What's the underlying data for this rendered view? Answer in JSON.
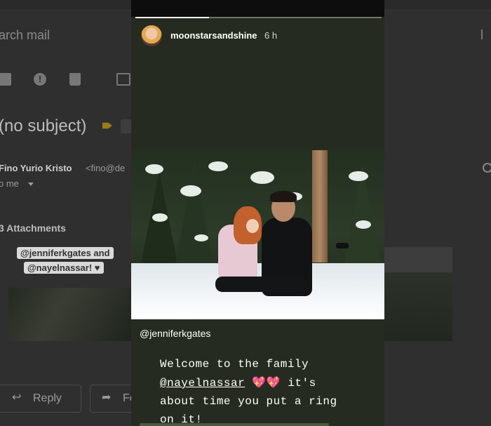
{
  "mail": {
    "search_placeholder": "arch mail",
    "subject": "(no subject)",
    "label_chip_text": "",
    "sender_name": "Fino Yurio Kristo",
    "sender_email": "<fino@de",
    "recipient": "o me",
    "attachments_heading": "3 Attachments",
    "attachment_tag_1": "@jenniferkgates and",
    "attachment_tag_2": "@nayelnassar! ♥",
    "reply_label": "Reply",
    "forward_label": "Fo",
    "spam_glyph": "!",
    "reply_icon": "↩",
    "forward_icon": "➦"
  },
  "story": {
    "username": "moonstarsandshine",
    "timestamp": "6 h",
    "progress": 0.3,
    "mention": "@jenniferkgates",
    "caption_line1": "Welcome to the family",
    "caption_handle": "@nayelnassar",
    "caption_emoji": "💖💖",
    "caption_line2_rest": " it's",
    "caption_line3": "about time you put a ring",
    "caption_line4": "on it!"
  },
  "colors": {
    "story_bg": "#262b21",
    "mail_bg": "#2f2f2f",
    "progress": "#ffffff"
  }
}
